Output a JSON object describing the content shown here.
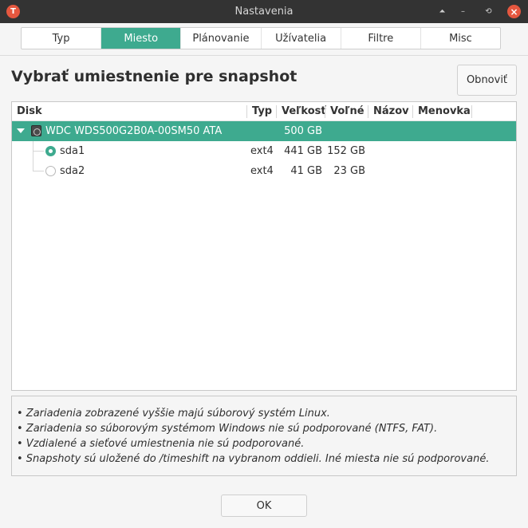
{
  "window": {
    "title": "Nastavenia",
    "app_icon": "T",
    "buttons": {
      "up": "⏶",
      "minimize": "–",
      "restore": "⟲",
      "close": "×"
    }
  },
  "tabs": [
    {
      "label": "Typ"
    },
    {
      "label": "Miesto",
      "active": true
    },
    {
      "label": "Plánovanie"
    },
    {
      "label": "Užívatelia"
    },
    {
      "label": "Filtre"
    },
    {
      "label": "Misc"
    }
  ],
  "heading": "Vybrať umiestnenie pre snapshot",
  "refresh_label": "Obnoviť",
  "table": {
    "columns": [
      "Disk",
      "Typ",
      "Veľkosť",
      "Voľné",
      "Názov",
      "Menovka"
    ],
    "disk": {
      "name": "WDC WDS500G2B0A-00SM50 ATA",
      "size": "500 GB"
    },
    "partitions": [
      {
        "name": "sda1",
        "type": "ext4",
        "size": "441 GB",
        "free": "152 GB",
        "selected": true
      },
      {
        "name": "sda2",
        "type": "ext4",
        "size": "41 GB",
        "free": "23 GB",
        "selected": false
      }
    ]
  },
  "notes": [
    "• Zariadenia zobrazené vyššie majú súborový systém Linux.",
    "• Zariadenia so súborovým systémom Windows nie sú podporované (NTFS, FAT).",
    "• Vzdialené a sieťové umiestnenia nie sú podporované.",
    "• Snapshoty sú uložené do /timeshift na vybranom oddieli. Iné miesta nie sú podporované."
  ],
  "ok_label": "OK",
  "colors": {
    "accent": "#3eaa8f",
    "titlebar": "#333333",
    "close": "#e5573f"
  }
}
